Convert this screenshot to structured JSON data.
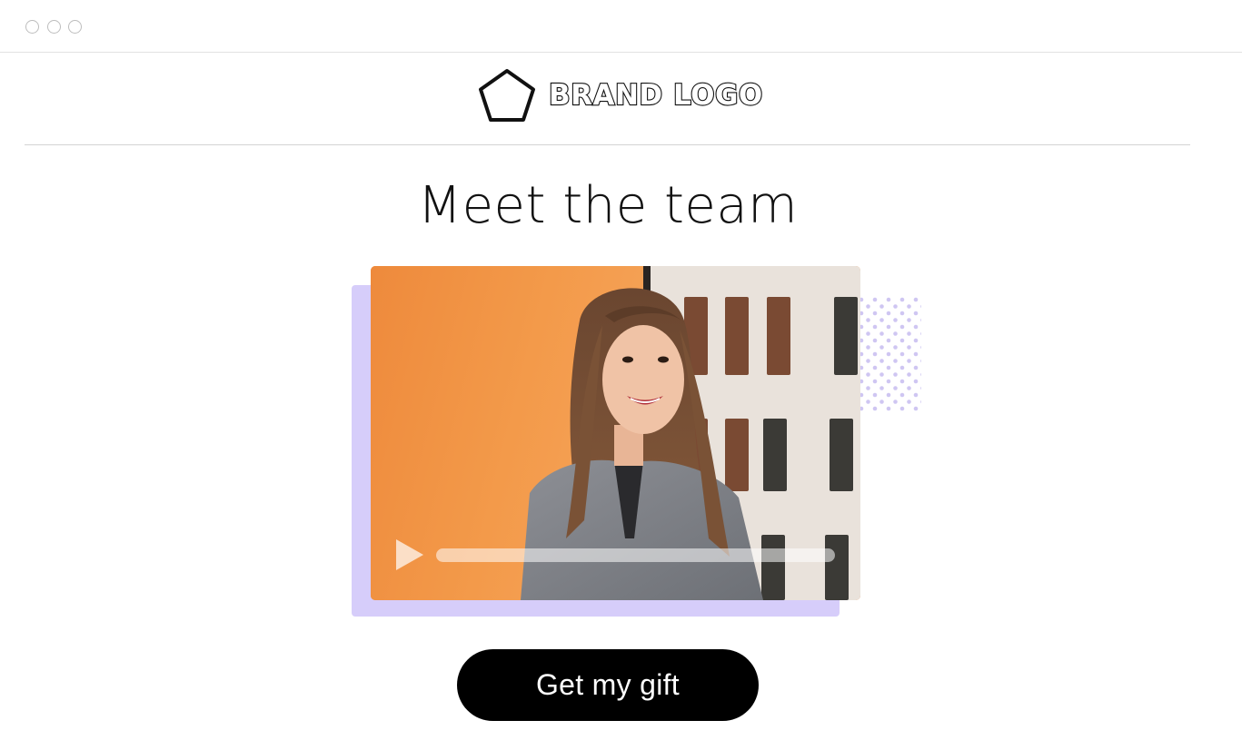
{
  "window": {
    "controls": [
      "window-dot",
      "window-dot",
      "window-dot"
    ]
  },
  "header": {
    "brand_text": "BRAND LOGO",
    "brand_icon": "pentagon-icon"
  },
  "main": {
    "title": "Meet the team",
    "video": {
      "play_icon": "play-icon",
      "progress": 0.0,
      "accent_color": "#d6cdfa",
      "scene": "smiling woman with long hair in grey blazer, orange wall and window background"
    },
    "cta": {
      "label": "Get my gift"
    }
  },
  "colors": {
    "accent": "#d6cdfa",
    "button": "#000000",
    "button_text": "#ffffff"
  }
}
